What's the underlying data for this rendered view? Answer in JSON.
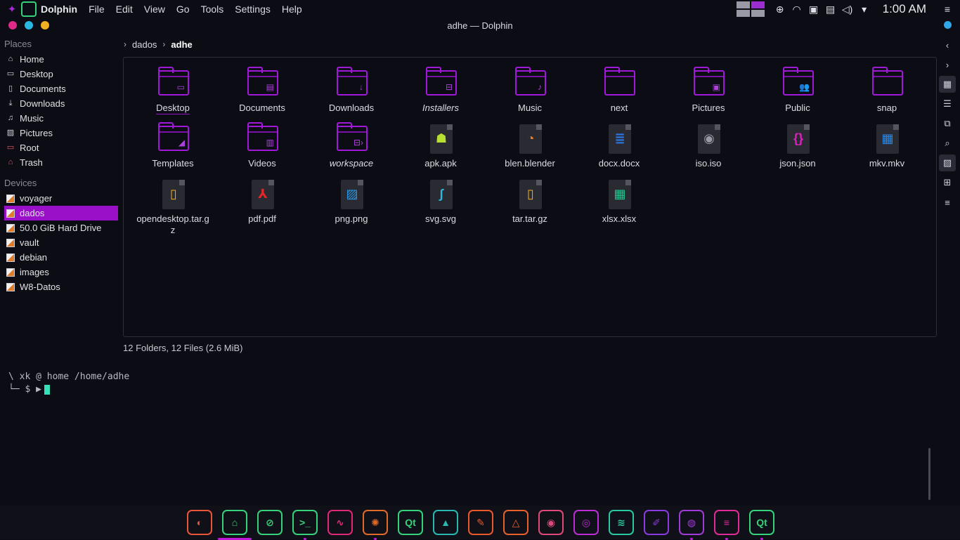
{
  "topbar": {
    "app_name": "Dolphin",
    "menu": [
      "File",
      "Edit",
      "View",
      "Go",
      "Tools",
      "Settings",
      "Help"
    ],
    "clock": "1:00 AM",
    "tray_icons": [
      "workspace-pager",
      "network-up-icon",
      "wifi-icon",
      "lock-icon",
      "clipboard-icon",
      "volume-icon",
      "tray-expand-icon",
      "hamburger-menu-icon"
    ]
  },
  "window": {
    "title": "adhe — Dolphin"
  },
  "places": {
    "header": "Places",
    "items": [
      {
        "label": "Home",
        "icon": "home-icon"
      },
      {
        "label": "Desktop",
        "icon": "desktop-icon"
      },
      {
        "label": "Documents",
        "icon": "documents-icon"
      },
      {
        "label": "Downloads",
        "icon": "downloads-icon"
      },
      {
        "label": "Music",
        "icon": "music-icon"
      },
      {
        "label": "Pictures",
        "icon": "pictures-icon"
      },
      {
        "label": "Root",
        "icon": "root-folder-icon"
      },
      {
        "label": "Trash",
        "icon": "trash-icon"
      }
    ]
  },
  "devices": {
    "header": "Devices",
    "items": [
      {
        "label": "voyager",
        "active": false
      },
      {
        "label": "dados",
        "active": true
      },
      {
        "label": "50.0 GiB Hard Drive",
        "active": false
      },
      {
        "label": "vault",
        "active": false
      },
      {
        "label": "debian",
        "active": false
      },
      {
        "label": "images",
        "active": false
      },
      {
        "label": "W8-Datos",
        "active": false
      }
    ]
  },
  "breadcrumb": {
    "crumbs": [
      "dados",
      "adhe"
    ]
  },
  "files": [
    {
      "name": "Desktop",
      "kind": "folder",
      "emblem": "▭"
    },
    {
      "name": "Documents",
      "kind": "folder",
      "emblem": "▤"
    },
    {
      "name": "Downloads",
      "kind": "folder",
      "emblem": "↓"
    },
    {
      "name": "Installers",
      "kind": "folder",
      "emblem": "⊟"
    },
    {
      "name": "Music",
      "kind": "folder",
      "emblem": "♪"
    },
    {
      "name": "next",
      "kind": "folder",
      "emblem": ""
    },
    {
      "name": "Pictures",
      "kind": "folder",
      "emblem": "▣"
    },
    {
      "name": "Public",
      "kind": "folder",
      "emblem": "👥"
    },
    {
      "name": "snap",
      "kind": "folder",
      "emblem": ""
    },
    {
      "name": "Templates",
      "kind": "folder",
      "emblem": "◢"
    },
    {
      "name": "Videos",
      "kind": "folder",
      "emblem": "▥"
    },
    {
      "name": "workspace",
      "kind": "folder",
      "emblem": "⊟›"
    },
    {
      "name": "apk.apk",
      "kind": "file",
      "glyph": "☗",
      "color": "#b8e030"
    },
    {
      "name": "blen.blender",
      "kind": "file",
      "glyph": "◔",
      "color": "#f07a20"
    },
    {
      "name": "docx.docx",
      "kind": "file",
      "glyph": "≣",
      "color": "#2a7ae8"
    },
    {
      "name": "iso.iso",
      "kind": "file",
      "glyph": "◉",
      "color": "#9a9aa6"
    },
    {
      "name": "json.json",
      "kind": "file",
      "glyph": "{}",
      "color": "#e020c0"
    },
    {
      "name": "mkv.mkv",
      "kind": "file",
      "glyph": "▦",
      "color": "#2a8ae8"
    },
    {
      "name": "opendesktop.tar.gz",
      "kind": "file",
      "glyph": "▯",
      "color": "#f0b020"
    },
    {
      "name": "pdf.pdf",
      "kind": "file",
      "glyph": "⅄",
      "color": "#e02828"
    },
    {
      "name": "png.png",
      "kind": "file",
      "glyph": "▨",
      "color": "#2a9ae8"
    },
    {
      "name": "svg.svg",
      "kind": "file",
      "glyph": "∫",
      "color": "#28b8e0"
    },
    {
      "name": "tar.tar.gz",
      "kind": "file",
      "glyph": "▯",
      "color": "#f0b020"
    },
    {
      "name": "xlsx.xlsx",
      "kind": "file",
      "glyph": "▦",
      "color": "#20c890"
    }
  ],
  "status": "12 Folders, 12 Files (2.6 MiB)",
  "terminal": {
    "line1": "\\ xk @ home /home/adhe",
    "line2": "└─ $ ▶"
  },
  "dock": {
    "apps": [
      {
        "name": "firefox",
        "glyph": "◐",
        "color": "#e8563a",
        "running": false
      },
      {
        "name": "dolphin",
        "glyph": "⌂",
        "color": "#35d27a",
        "running": true
      },
      {
        "name": "system-settings",
        "glyph": "⊘",
        "color": "#35d27a",
        "running": false
      },
      {
        "name": "konsole",
        "glyph": ">_",
        "color": "#35d27a",
        "running": true
      },
      {
        "name": "system-monitor",
        "glyph": "∿",
        "color": "#e02878",
        "running": false
      },
      {
        "name": "ark",
        "glyph": "✺",
        "color": "#e06a2a",
        "running": true
      },
      {
        "name": "qt-designer",
        "glyph": "Qt",
        "color": "#35d27a",
        "running": false
      },
      {
        "name": "inkscape",
        "glyph": "▲",
        "color": "#28b8b0",
        "running": false
      },
      {
        "name": "gimp",
        "glyph": "✎",
        "color": "#e85a2a",
        "running": false
      },
      {
        "name": "vlc",
        "glyph": "△",
        "color": "#e8602a",
        "running": false
      },
      {
        "name": "eye-viewer",
        "glyph": "◉",
        "color": "#e04a7a",
        "running": false
      },
      {
        "name": "screenshot",
        "glyph": "◎",
        "color": "#c02ad8",
        "running": false
      },
      {
        "name": "audio-editor",
        "glyph": "≋",
        "color": "#28c8a0",
        "running": false
      },
      {
        "name": "krita",
        "glyph": "✐",
        "color": "#8a3ae0",
        "running": false
      },
      {
        "name": "chromium",
        "glyph": "◍",
        "color": "#a03ad8",
        "running": true
      },
      {
        "name": "text-editor",
        "glyph": "≡",
        "color": "#e02a9a",
        "running": true
      },
      {
        "name": "qt-creator",
        "glyph": "Qt",
        "color": "#35d27a",
        "running": true
      }
    ]
  }
}
